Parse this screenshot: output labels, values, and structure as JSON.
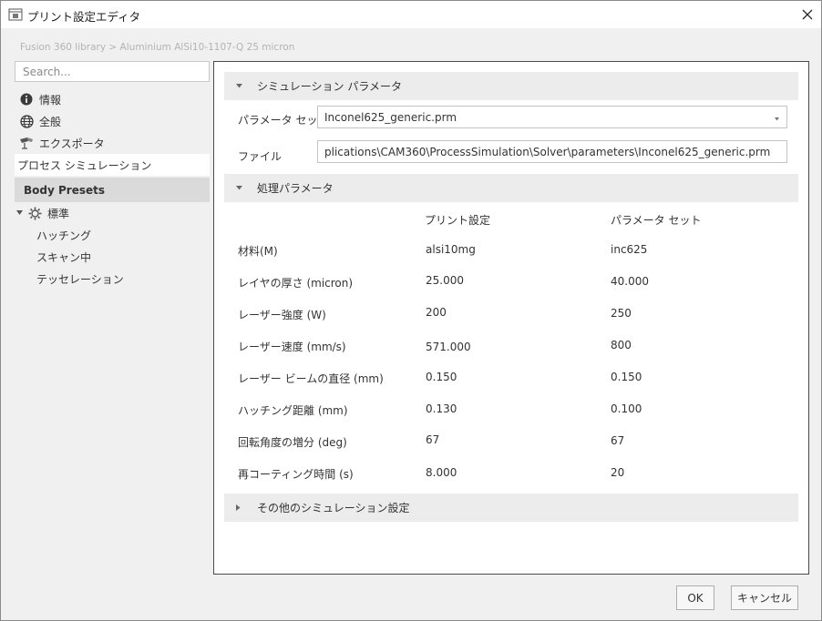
{
  "window": {
    "title": "プリント設定エディタ"
  },
  "breadcrumb": "Fusion 360 library > Aluminium AlSi10-1107-Q 25 micron",
  "search": {
    "placeholder": "Search..."
  },
  "sidebar": {
    "items": [
      {
        "label": "情報",
        "icon": "info-icon"
      },
      {
        "label": "全般",
        "icon": "globe-icon"
      },
      {
        "label": "エクスポータ",
        "icon": "exporter-icon"
      },
      {
        "label": "プロセス シミュレーション",
        "icon": ""
      }
    ],
    "presets_header": "Body Presets",
    "tree": {
      "root_label": "標準",
      "children": [
        "ハッチング",
        "スキャン中",
        "テッセレーション"
      ]
    }
  },
  "sim_section": {
    "title": "シミュレーション パラメータ",
    "param_set_label": "パラメータ セット",
    "param_set_value": "Inconel625_generic.prm",
    "file_label": "ファイル",
    "file_value": "plications\\CAM360\\ProcessSimulation\\Solver\\parameters\\Inconel625_generic.prm"
  },
  "proc_section": {
    "title": "処理パラメータ",
    "col_print": "プリント設定",
    "col_param": "パラメータ セット",
    "rows": [
      {
        "label": "材料(M)",
        "print": "alsi10mg",
        "param": "inc625"
      },
      {
        "label": "レイヤの厚さ (micron)",
        "print": "25.000",
        "param": "40.000"
      },
      {
        "label": "レーザー強度 (W)",
        "print": "200",
        "param": "250"
      },
      {
        "label": "レーザー速度 (mm/s)",
        "print": "571.000",
        "param": "800"
      },
      {
        "label": "レーザー ビームの直径 (mm)",
        "print": "0.150",
        "param": "0.150"
      },
      {
        "label": "ハッチング距離 (mm)",
        "print": "0.130",
        "param": "0.100"
      },
      {
        "label": "回転角度の増分 (deg)",
        "print": "67",
        "param": "67"
      },
      {
        "label": "再コーティング時間 (s)",
        "print": "8.000",
        "param": "20"
      }
    ]
  },
  "other_section": {
    "title": "その他のシミュレーション設定"
  },
  "footer": {
    "ok": "OK",
    "cancel": "キャンセル"
  }
}
